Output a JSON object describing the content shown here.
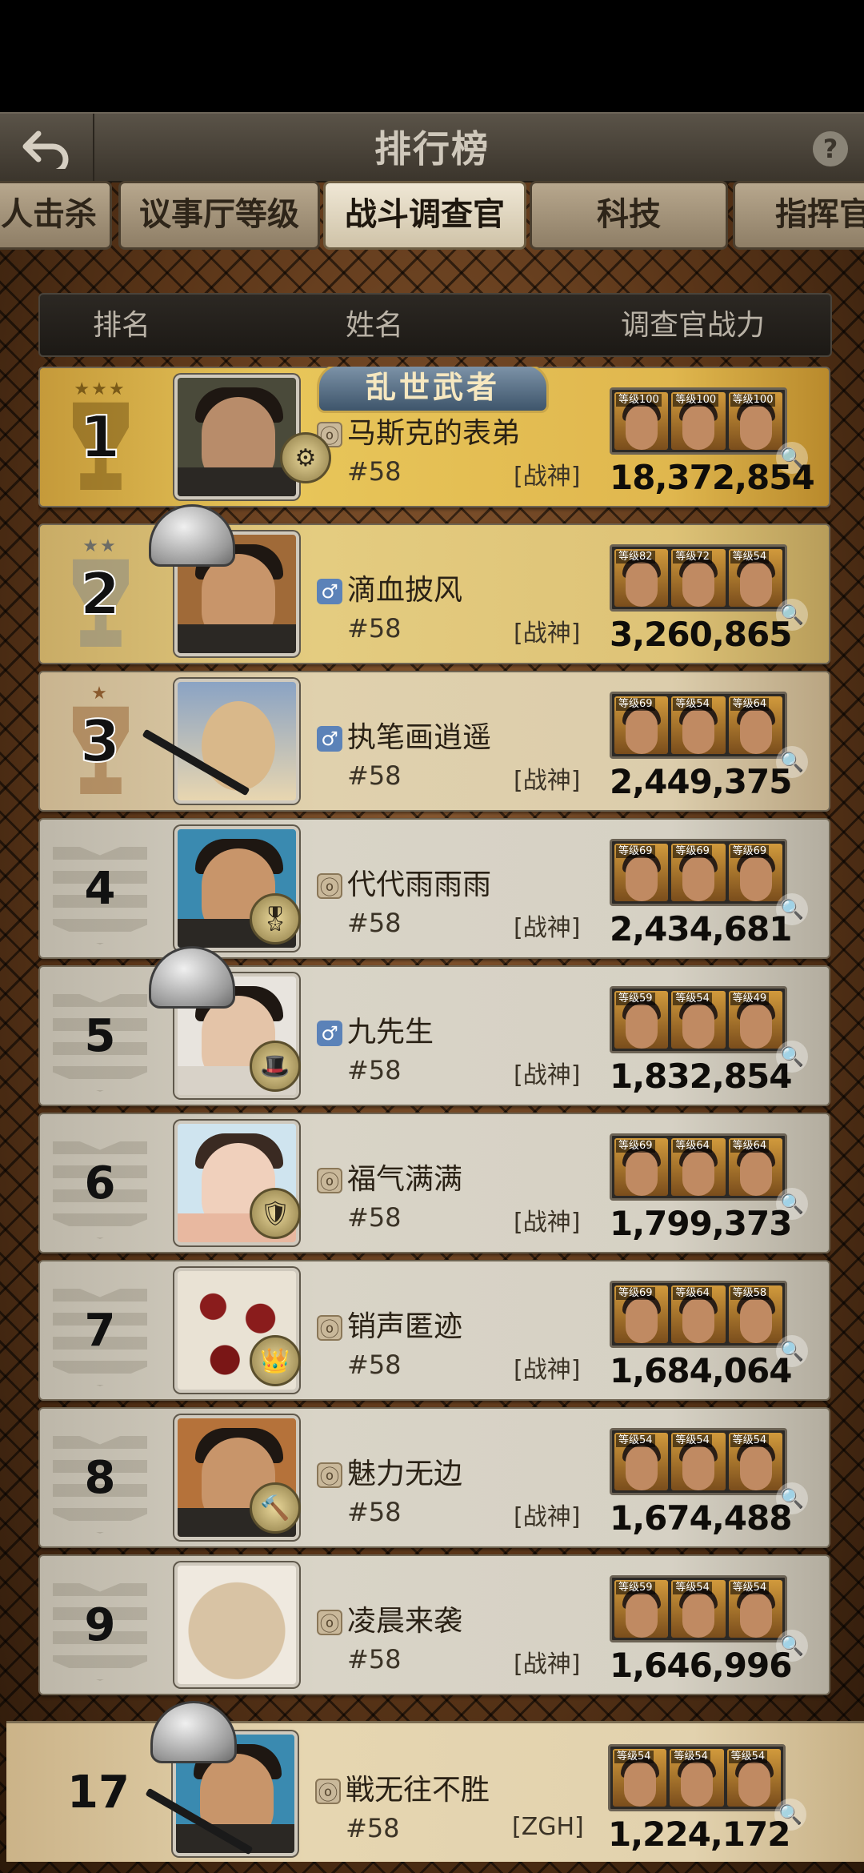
{
  "header": {
    "title": "排行榜",
    "help": "?"
  },
  "tabs": [
    {
      "label": "人击杀",
      "active": false
    },
    {
      "label": "议事厅等级",
      "active": false
    },
    {
      "label": "战斗调查官",
      "active": true
    },
    {
      "label": "科技",
      "active": false
    },
    {
      "label": "指挥官",
      "active": false
    }
  ],
  "columns": {
    "rank": "排名",
    "name": "姓名",
    "power": "调查官战力"
  },
  "top_title": "乱世武者",
  "rows": [
    {
      "rank": "1",
      "name": "马斯克的表弟",
      "server": "#58",
      "alliance": "[战神]",
      "power": "18,372,854",
      "levels": [
        "等级100",
        "等级100",
        "等级100"
      ]
    },
    {
      "rank": "2",
      "name": "滴血披风",
      "server": "#58",
      "alliance": "[战神]",
      "power": "3,260,865",
      "levels": [
        "等级82",
        "等级72",
        "等级54"
      ]
    },
    {
      "rank": "3",
      "name": "执笔画逍遥",
      "server": "#58",
      "alliance": "[战神]",
      "power": "2,449,375",
      "levels": [
        "等级69",
        "等级54",
        "等级64"
      ]
    },
    {
      "rank": "4",
      "name": "代代雨雨雨",
      "server": "#58",
      "alliance": "[战神]",
      "power": "2,434,681",
      "levels": [
        "等级69",
        "等级69",
        "等级69"
      ]
    },
    {
      "rank": "5",
      "name": "九先生",
      "server": "#58",
      "alliance": "[战神]",
      "power": "1,832,854",
      "levels": [
        "等级59",
        "等级54",
        "等级49"
      ]
    },
    {
      "rank": "6",
      "name": "福气满满",
      "server": "#58",
      "alliance": "[战神]",
      "power": "1,799,373",
      "levels": [
        "等级69",
        "等级64",
        "等级64"
      ]
    },
    {
      "rank": "7",
      "name": "销声匿迹",
      "server": "#58",
      "alliance": "[战神]",
      "power": "1,684,064",
      "levels": [
        "等级69",
        "等级64",
        "等级58"
      ]
    },
    {
      "rank": "8",
      "name": "魅力无边",
      "server": "#58",
      "alliance": "[战神]",
      "power": "1,674,488",
      "levels": [
        "等级54",
        "等级54",
        "等级54"
      ]
    },
    {
      "rank": "9",
      "name": "凌晨来袭",
      "server": "#58",
      "alliance": "[战神]",
      "power": "1,646,996",
      "levels": [
        "等级59",
        "等级54",
        "等级54"
      ]
    }
  ],
  "self": {
    "rank": "17",
    "name": "戦无往不胜",
    "server": "#58",
    "alliance": "[ZGH]",
    "power": "1,224,172",
    "levels": [
      "等级54",
      "等级54",
      "等级54"
    ]
  },
  "colors": {
    "gold": "#e8c65a",
    "silver_row": "#d9d4c7",
    "male_badge": "#5b82b8"
  }
}
